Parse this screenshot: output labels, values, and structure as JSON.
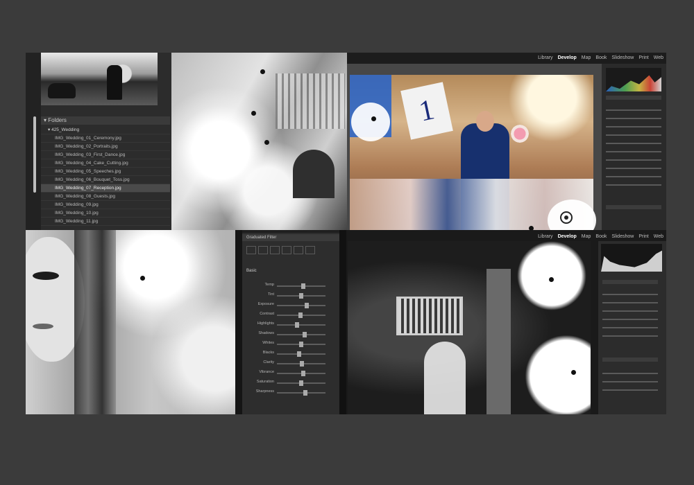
{
  "top_left": {
    "folders_header": "▾ Folders",
    "folder_rows": [
      {
        "label": "▾ 425_Wedding",
        "type": "folder"
      },
      {
        "label": "IMG_Wedding_01_Ceremony.jpg",
        "type": "file"
      },
      {
        "label": "IMG_Wedding_02_Portraits.jpg",
        "type": "file"
      },
      {
        "label": "IMG_Wedding_03_First_Dance.jpg",
        "type": "file"
      },
      {
        "label": "IMG_Wedding_04_Cake_Cutting.jpg",
        "type": "file"
      },
      {
        "label": "IMG_Wedding_05_Speeches.jpg",
        "type": "file"
      },
      {
        "label": "IMG_Wedding_06_Bouquet_Toss.jpg",
        "type": "file"
      },
      {
        "label": "IMG_Wedding_07_Reception.jpg",
        "type": "file",
        "selected": true
      },
      {
        "label": "IMG_Wedding_08_Guests.jpg",
        "type": "file"
      },
      {
        "label": "IMG_Wedding_09.jpg",
        "type": "file"
      },
      {
        "label": "IMG_Wedding_10.jpg",
        "type": "file"
      },
      {
        "label": "IMG_Wedding_11.jpg",
        "type": "file"
      }
    ]
  },
  "top_right": {
    "menu": [
      "Library",
      "Develop",
      "Map",
      "Book",
      "Slideshow",
      "Print",
      "Web"
    ],
    "active_menu": "Develop",
    "card_number": "1"
  },
  "bottom_middle": {
    "header": "Graduated Filter",
    "section_title": "Basic",
    "sliders": [
      {
        "label": "Temp",
        "value": 0.55
      },
      {
        "label": "Tint",
        "value": 0.5
      },
      {
        "label": "Exposure",
        "value": 0.62
      },
      {
        "label": "Contrast",
        "value": 0.48
      },
      {
        "label": "Highlights",
        "value": 0.4
      },
      {
        "label": "Shadows",
        "value": 0.58
      },
      {
        "label": "Whites",
        "value": 0.5
      },
      {
        "label": "Blacks",
        "value": 0.45
      },
      {
        "label": "Clarity",
        "value": 0.52
      },
      {
        "label": "Vibrance",
        "value": 0.55
      },
      {
        "label": "Saturation",
        "value": 0.5
      },
      {
        "label": "Sharpness",
        "value": 0.6
      }
    ]
  },
  "bottom_right": {
    "menu": [
      "Library",
      "Develop",
      "Map",
      "Book",
      "Slideshow",
      "Print",
      "Web"
    ],
    "active_menu": "Develop"
  },
  "colors": {
    "background": "#3b3b3b",
    "panel": "#2c2c2c",
    "accent_blue": "#1b2b7a"
  }
}
